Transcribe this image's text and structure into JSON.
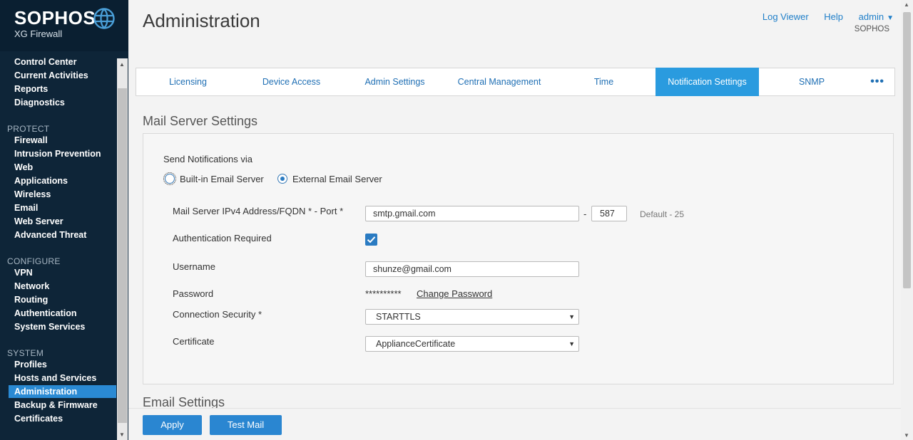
{
  "brand": {
    "name": "SOPHOS",
    "product": "XG Firewall",
    "globe_icon": "globe-icon"
  },
  "sidebar": {
    "top_items": [
      "Control Center",
      "Current Activities",
      "Reports",
      "Diagnostics"
    ],
    "groups": [
      {
        "title": "PROTECT",
        "items": [
          "Firewall",
          "Intrusion Prevention",
          "Web",
          "Applications",
          "Wireless",
          "Email",
          "Web Server",
          "Advanced Threat"
        ]
      },
      {
        "title": "CONFIGURE",
        "items": [
          "VPN",
          "Network",
          "Routing",
          "Authentication",
          "System Services"
        ]
      },
      {
        "title": "SYSTEM",
        "items": [
          "Profiles",
          "Hosts and Services",
          "Administration",
          "Backup & Firmware",
          "Certificates"
        ]
      }
    ],
    "active": "Administration"
  },
  "header": {
    "title": "Administration",
    "log_viewer": "Log Viewer",
    "help": "Help",
    "user": "admin",
    "org": "SOPHOS"
  },
  "tabs": [
    "Licensing",
    "Device Access",
    "Admin Settings",
    "Central Management",
    "Time",
    "Notification Settings",
    "SNMP"
  ],
  "active_tab": "Notification Settings",
  "mail_server": {
    "section_title": "Mail Server Settings",
    "send_via_label": "Send Notifications via",
    "option_builtin": "Built-in Email Server",
    "option_external": "External Email Server",
    "selected_option": "External Email Server",
    "address_label": "Mail Server IPv4 Address/FQDN *  -  Port *",
    "address_value": "smtp.gmail.com",
    "port_sep": "-",
    "port_value": "587",
    "port_hint": "Default - 25",
    "auth_label": "Authentication Required",
    "auth_checked": true,
    "username_label": "Username",
    "username_value": "shunze@gmail.com",
    "password_label": "Password",
    "password_mask": "**********",
    "change_password": "Change Password",
    "security_label": "Connection Security *",
    "security_value": "STARTTLS",
    "certificate_label": "Certificate",
    "certificate_value": "ApplianceCertificate"
  },
  "email_settings": {
    "section_title": "Email Settings"
  },
  "buttons": {
    "apply": "Apply",
    "test_mail": "Test Mail"
  },
  "colors": {
    "sidebar_bg": "#0e2538",
    "accent": "#2a9bdf",
    "button": "#2a86d1",
    "link": "#1f7fc9"
  }
}
